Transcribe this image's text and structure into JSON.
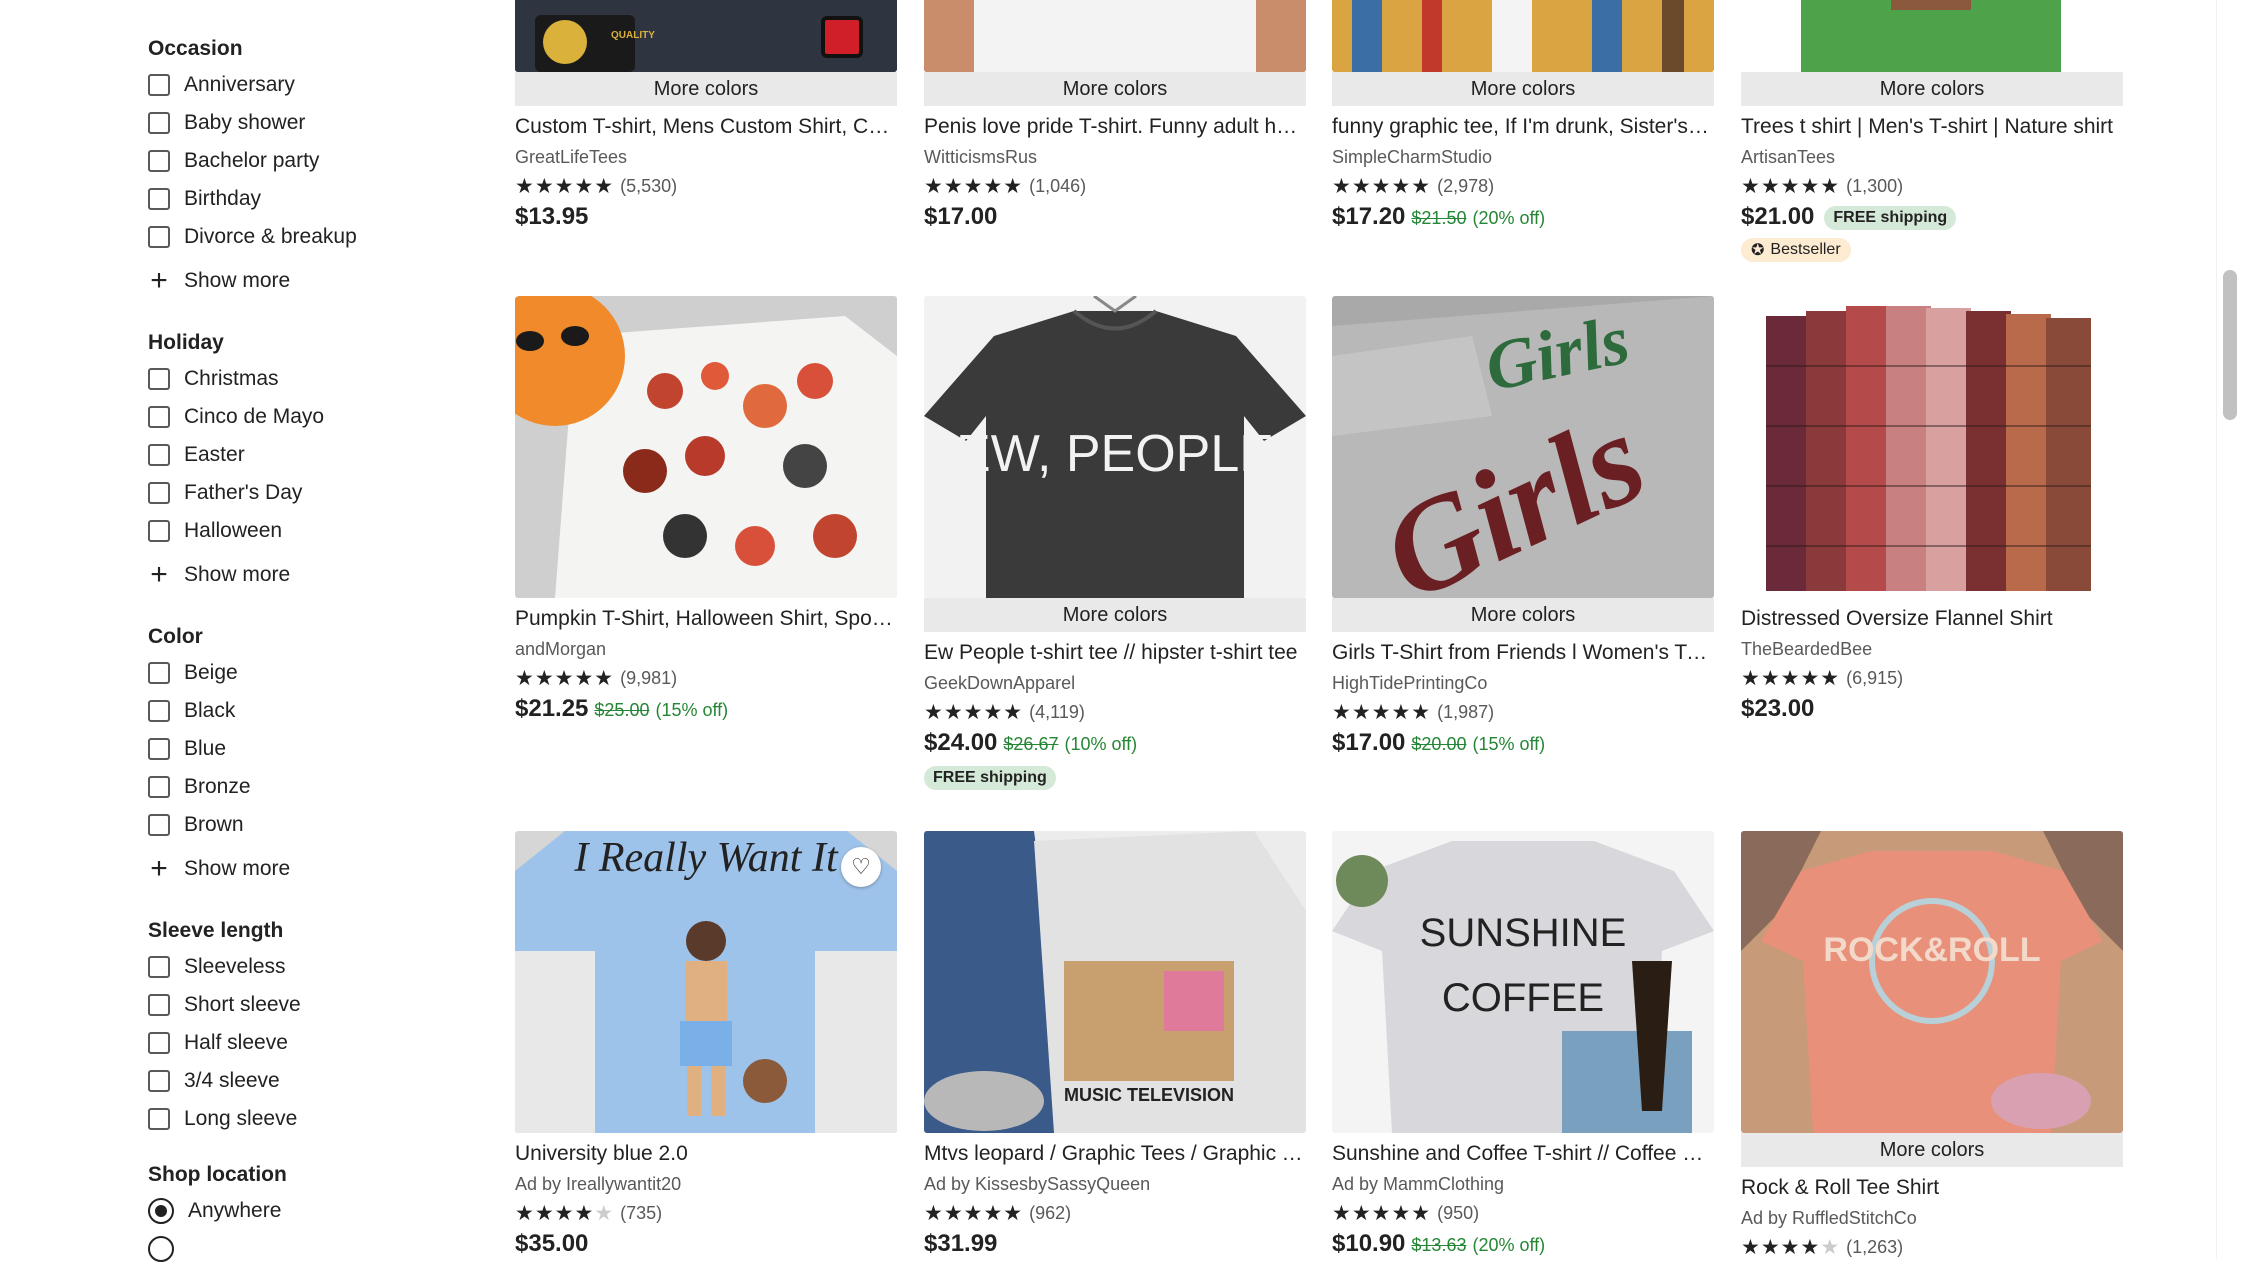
{
  "sidebar": {
    "occasion": {
      "title": "Occasion",
      "items": [
        "Anniversary",
        "Baby shower",
        "Bachelor party",
        "Birthday",
        "Divorce & breakup"
      ],
      "show_more": "Show more"
    },
    "holiday": {
      "title": "Holiday",
      "items": [
        "Christmas",
        "Cinco de Mayo",
        "Easter",
        "Father's Day",
        "Halloween"
      ],
      "show_more": "Show more"
    },
    "color": {
      "title": "Color",
      "items": [
        "Beige",
        "Black",
        "Blue",
        "Bronze",
        "Brown"
      ],
      "show_more": "Show more"
    },
    "sleeve": {
      "title": "Sleeve length",
      "items": [
        "Sleeveless",
        "Short sleeve",
        "Half sleeve",
        "3/4 sleeve",
        "Long sleeve"
      ]
    },
    "location": {
      "title": "Shop location",
      "selected": "Anywhere"
    }
  },
  "row1": [
    {
      "more_colors": "More colors",
      "title": "Custom T-shirt, Mens Custom Shirt, Custom Text Shirt",
      "shop": "GreatLifeTees",
      "reviews": "(5,530)",
      "price": "$13.95"
    },
    {
      "more_colors": "More colors",
      "title": "Penis love pride T-shirt. Funny adult humor shirt",
      "shop": "WitticismsRus",
      "reviews": "(1,046)",
      "price": "$17.00"
    },
    {
      "more_colors": "More colors",
      "title": "funny graphic tee, If I'm drunk, Sister's fault shirt",
      "shop": "SimpleCharmStudio",
      "reviews": "(2,978)",
      "price": "$17.20",
      "old_price": "$21.50",
      "discount": "(20% off)"
    },
    {
      "more_colors": "More colors",
      "title": "Trees t shirt | Men's T-shirt | Nature shirt",
      "shop": "ArtisanTees",
      "reviews": "(1,300)",
      "price": "$21.00",
      "free_shipping": "FREE shipping",
      "badge": "Bestseller"
    }
  ],
  "row2": [
    {
      "title": "Pumpkin T-Shirt, Halloween Shirt, Spooky Season Tee",
      "shop": "andMorgan",
      "reviews": "(9,981)",
      "price": "$21.25",
      "old_price": "$25.00",
      "discount": "(15% off)"
    },
    {
      "more_colors": "More colors",
      "title": "Ew People t-shirt tee // hipster t-shirt tee",
      "shop": "GeekDownApparel",
      "reviews": "(4,119)",
      "price": "$24.00",
      "old_price": "$26.67",
      "discount": "(10% off)",
      "free_shipping": "FREE shipping",
      "shirt_text": "EW, PEOPLE"
    },
    {
      "more_colors": "More colors",
      "title": "Girls T-Shirt from Friends l Women's T-shirt",
      "shop": "HighTidePrintingCo",
      "reviews": "(1,987)",
      "price": "$17.00",
      "old_price": "$20.00",
      "discount": "(15% off)",
      "shirt_text": "Girls"
    },
    {
      "title": "Distressed Oversize Flannel Shirt",
      "shop": "TheBeardedBee",
      "reviews": "(6,915)",
      "price": "$23.00"
    }
  ],
  "row3": [
    {
      "title": "University blue 2.0",
      "shop": "Ad by Ireallywantit20",
      "reviews": "(735)",
      "price": "$35.00",
      "rating": 4
    },
    {
      "title": "Mtvs leopard / Graphic Tees / Graphic T-shirt",
      "shop": "Ad by KissesbySassyQueen",
      "reviews": "(962)",
      "price": "$31.99",
      "shirt_text": "MUSIC TELEVISION"
    },
    {
      "title": "Sunshine and Coffee T-shirt // Coffee Lover Tee",
      "shop": "Ad by MammClothing",
      "reviews": "(950)",
      "price": "$10.90",
      "old_price": "$13.63",
      "discount": "(20% off)",
      "shirt_text_1": "SUNSHINE",
      "shirt_text_2": "COFFEE"
    },
    {
      "more_colors": "More colors",
      "title": "Rock & Roll Tee Shirt",
      "shop": "Ad by RuffledStitchCo",
      "reviews": "(1,263)",
      "shirt_text": "ROCK&ROLL"
    }
  ],
  "stars": "★★★★★",
  "colors": {
    "sale_green": "#258635",
    "free_ship_bg": "#d4e9d7",
    "bestseller_bg": "#fdebd2"
  }
}
